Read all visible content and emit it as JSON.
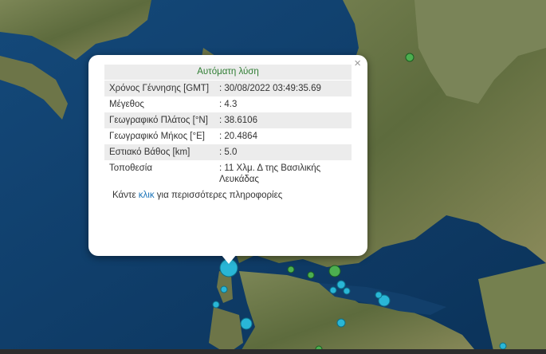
{
  "popup": {
    "title": "Αυτόματη λύση",
    "close_glyph": "×",
    "rows": [
      {
        "label": "Χρόνος Γέννησης [GMT]",
        "value": ": 30/08/2022 03:49:35.69"
      },
      {
        "label": "Μέγεθος",
        "value": ": 4.3"
      },
      {
        "label": "Γεωγραφικό Πλάτος [°N]",
        "value": ": 38.6106"
      },
      {
        "label": "Γεωγραφικό Μήκος [°E]",
        "value": ": 20.4864"
      },
      {
        "label": "Εστιακό Βάθος [km]",
        "value": ": 5.0"
      },
      {
        "label": "Τοποθεσία",
        "value": ": 11 Χλμ. Δ της Βασιλικής Λευκάδας"
      }
    ],
    "more_prefix": "Κάντε ",
    "more_link": "κλικ",
    "more_suffix": " για περισσότερες πληροφορίες"
  },
  "colors": {
    "sea": "#0d3b66",
    "land": "#6f7a4e",
    "marker_green": "#4caf50",
    "marker_cyan": "#29b6d6",
    "title_text": "#2e7d32",
    "link": "#1a73b8"
  },
  "icons": {
    "close": "close-icon",
    "marker": "earthquake-marker-icon"
  }
}
